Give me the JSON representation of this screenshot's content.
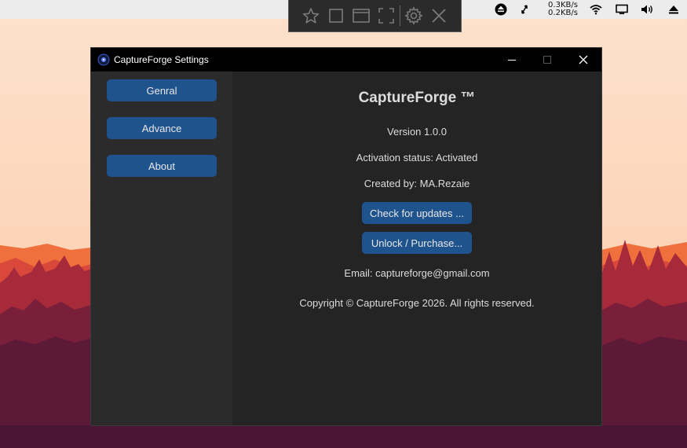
{
  "topbar": {
    "net_up": "0.3KB/s",
    "net_down": "0.2KB/s",
    "tray_icons": [
      "eject-circle-icon",
      "sync-icon",
      "wifi-icon",
      "display-icon",
      "volume-icon",
      "eject-icon"
    ]
  },
  "capture_toolbar": {
    "icons": [
      "star-icon",
      "square-icon",
      "window-icon",
      "fullscreen-icon",
      "gear-icon",
      "close-icon"
    ]
  },
  "window": {
    "title": "CaptureForge Settings",
    "controls": [
      "minimize-icon",
      "maximize-icon",
      "close-icon"
    ]
  },
  "sidebar": {
    "items": [
      {
        "label": "Genral"
      },
      {
        "label": "Advance"
      },
      {
        "label": "About"
      }
    ]
  },
  "about": {
    "app_name": "CaptureForge ™",
    "version": "Version 1.0.0",
    "activation": "Activation status: Activated",
    "created_by": "Created by: MA.Rezaie",
    "check_updates_label": "Check for updates ...",
    "unlock_label": "Unlock / Purchase...",
    "email": "Email: captureforge@gmail.com",
    "copyright": "Copyright © CaptureForge 2026. All rights reserved."
  },
  "colors": {
    "accent": "#1f538d",
    "sidebar_bg": "#2b2b2b",
    "content_bg": "#242424",
    "titlebar_bg": "#000000"
  }
}
